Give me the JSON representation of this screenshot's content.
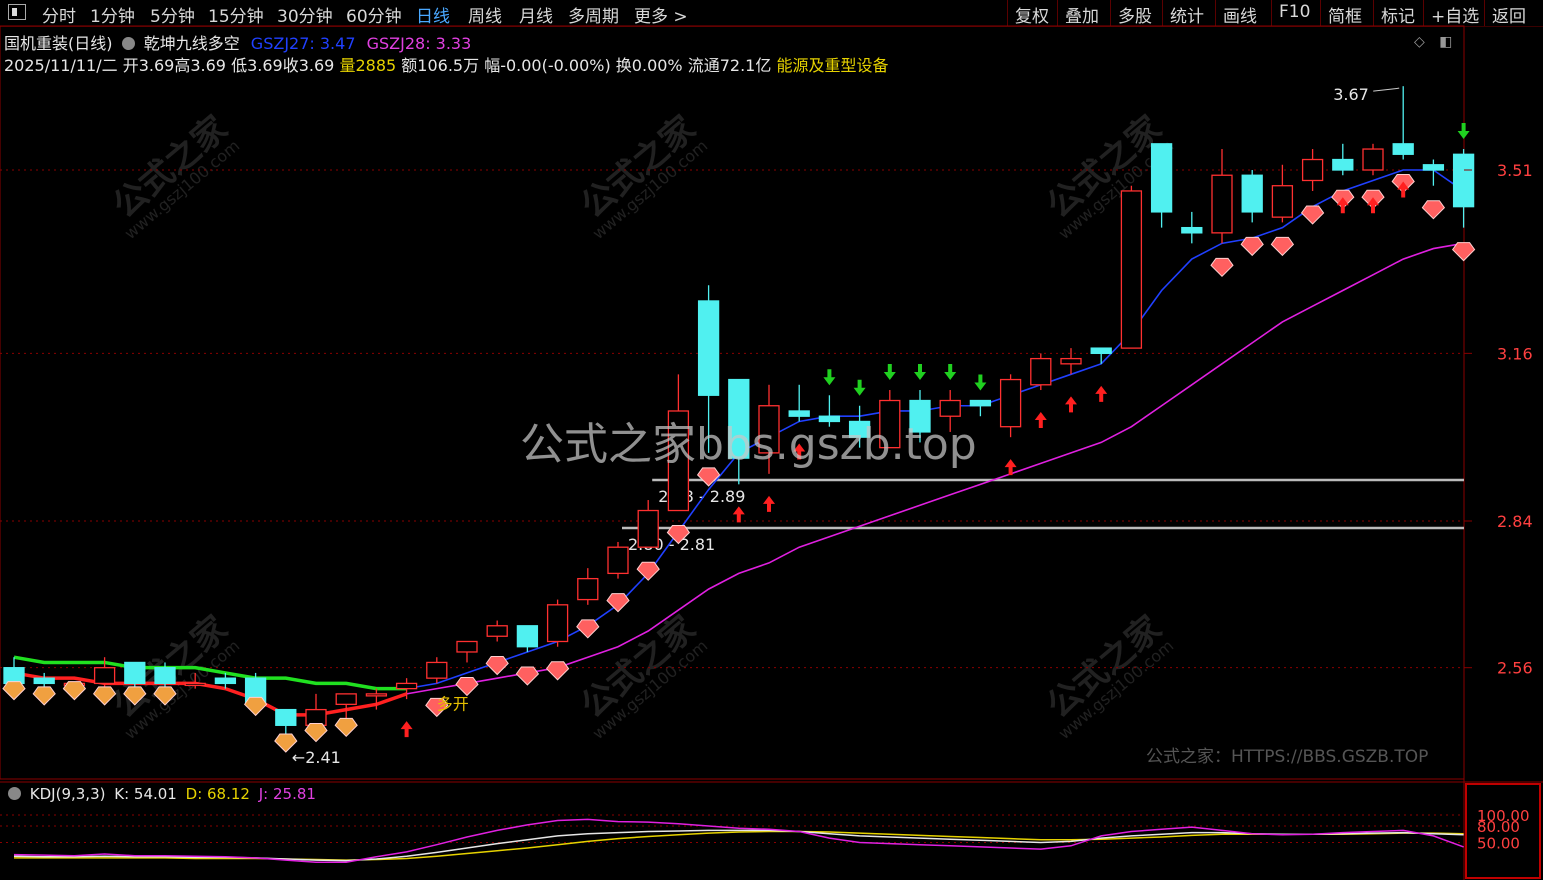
{
  "menu": {
    "left_items": [
      "分时",
      "1分钟",
      "5分钟",
      "15分钟",
      "30分钟",
      "60分钟",
      "日线",
      "周线",
      "月线",
      "多周期",
      "更多 >"
    ],
    "active": "日线",
    "right_items": [
      "复权",
      "叠加",
      "多股",
      "统计",
      "画线",
      "F10",
      "简框",
      "标记",
      "+自选",
      "返回"
    ]
  },
  "header": {
    "stock_name": "国机重装(日线)",
    "indicator_name": "乾坤九线多空",
    "ind1": "GSZJ27: 3.47",
    "ind2": "GSZJ28: 3.33",
    "date": "2025/11/11/二",
    "open": "开3.69",
    "high": "高3.69",
    "low": "低3.69",
    "close": "收3.69",
    "volume": "量2885",
    "amount": "额106.5万",
    "change": "幅-0.00(-0.00%)",
    "turnover": "换0.00%",
    "float_cap": "流通72.1亿",
    "sector": "能源及重型设备"
  },
  "colors": {
    "up": "#ff3030",
    "down": "#50f0f0",
    "ma_blue": "#2040ff",
    "ma_purple": "#e020e0",
    "bull_line": "#20e020",
    "bear_line": "#ff2020",
    "arrow_up": "#ff2020",
    "arrow_down": "#20d020",
    "bg": "#000000",
    "grid": "#8a0000"
  },
  "chart_data": {
    "type": "candlestick",
    "price_axis_ticks": [
      "3.51",
      "3.16",
      "2.84",
      "2.56"
    ],
    "candles": [
      {
        "o": 2.56,
        "h": 2.58,
        "l": 2.52,
        "c": 2.53
      },
      {
        "o": 2.54,
        "h": 2.55,
        "l": 2.51,
        "c": 2.53
      },
      {
        "o": 2.53,
        "h": 2.53,
        "l": 2.52,
        "c": 2.53
      },
      {
        "o": 2.53,
        "h": 2.58,
        "l": 2.51,
        "c": 2.56
      },
      {
        "o": 2.57,
        "h": 2.57,
        "l": 2.51,
        "c": 2.53
      },
      {
        "o": 2.56,
        "h": 2.57,
        "l": 2.51,
        "c": 2.53
      },
      {
        "o": 2.53,
        "h": 2.55,
        "l": 2.52,
        "c": 2.53
      },
      {
        "o": 2.54,
        "h": 2.55,
        "l": 2.52,
        "c": 2.53
      },
      {
        "o": 2.54,
        "h": 2.55,
        "l": 2.49,
        "c": 2.49
      },
      {
        "o": 2.48,
        "h": 2.48,
        "l": 2.42,
        "c": 2.45
      },
      {
        "o": 2.45,
        "h": 2.51,
        "l": 2.44,
        "c": 2.48
      },
      {
        "o": 2.49,
        "h": 2.51,
        "l": 2.45,
        "c": 2.51
      },
      {
        "o": 2.51,
        "h": 2.52,
        "l": 2.48,
        "c": 2.51
      },
      {
        "o": 2.52,
        "h": 2.54,
        "l": 2.5,
        "c": 2.53
      },
      {
        "o": 2.54,
        "h": 2.58,
        "l": 2.53,
        "c": 2.57
      },
      {
        "o": 2.59,
        "h": 2.61,
        "l": 2.57,
        "c": 2.61
      },
      {
        "o": 2.62,
        "h": 2.65,
        "l": 2.61,
        "c": 2.64
      },
      {
        "o": 2.64,
        "h": 2.64,
        "l": 2.59,
        "c": 2.6
      },
      {
        "o": 2.61,
        "h": 2.69,
        "l": 2.6,
        "c": 2.68
      },
      {
        "o": 2.69,
        "h": 2.75,
        "l": 2.68,
        "c": 2.73
      },
      {
        "o": 2.74,
        "h": 2.8,
        "l": 2.73,
        "c": 2.79
      },
      {
        "o": 2.79,
        "h": 2.88,
        "l": 2.79,
        "c": 2.86
      },
      {
        "o": 2.86,
        "h": 3.12,
        "l": 2.86,
        "c": 3.05
      },
      {
        "o": 3.26,
        "h": 3.29,
        "l": 2.97,
        "c": 3.08
      },
      {
        "o": 3.11,
        "h": 3.11,
        "l": 2.91,
        "c": 2.96
      },
      {
        "o": 2.97,
        "h": 3.1,
        "l": 2.93,
        "c": 3.06
      },
      {
        "o": 3.05,
        "h": 3.1,
        "l": 3.03,
        "c": 3.04
      },
      {
        "o": 3.04,
        "h": 3.08,
        "l": 3.02,
        "c": 3.03
      },
      {
        "o": 3.03,
        "h": 3.06,
        "l": 2.98,
        "c": 3.0
      },
      {
        "o": 2.98,
        "h": 3.09,
        "l": 2.98,
        "c": 3.07
      },
      {
        "o": 3.07,
        "h": 3.09,
        "l": 2.99,
        "c": 3.01
      },
      {
        "o": 3.04,
        "h": 3.09,
        "l": 3.01,
        "c": 3.07
      },
      {
        "o": 3.07,
        "h": 3.07,
        "l": 3.04,
        "c": 3.06
      },
      {
        "o": 3.02,
        "h": 3.12,
        "l": 3.0,
        "c": 3.11
      },
      {
        "o": 3.1,
        "h": 3.16,
        "l": 3.09,
        "c": 3.15
      },
      {
        "o": 3.14,
        "h": 3.17,
        "l": 3.12,
        "c": 3.15
      },
      {
        "o": 3.17,
        "h": 3.17,
        "l": 3.14,
        "c": 3.16
      },
      {
        "o": 3.17,
        "h": 3.48,
        "l": 3.17,
        "c": 3.47
      },
      {
        "o": 3.56,
        "h": 3.56,
        "l": 3.4,
        "c": 3.43
      },
      {
        "o": 3.4,
        "h": 3.43,
        "l": 3.37,
        "c": 3.39
      },
      {
        "o": 3.39,
        "h": 3.55,
        "l": 3.37,
        "c": 3.5
      },
      {
        "o": 3.5,
        "h": 3.51,
        "l": 3.41,
        "c": 3.43
      },
      {
        "o": 3.42,
        "h": 3.52,
        "l": 3.41,
        "c": 3.48
      },
      {
        "o": 3.49,
        "h": 3.55,
        "l": 3.47,
        "c": 3.53
      },
      {
        "o": 3.53,
        "h": 3.56,
        "l": 3.5,
        "c": 3.51
      },
      {
        "o": 3.51,
        "h": 3.56,
        "l": 3.5,
        "c": 3.55
      },
      {
        "o": 3.56,
        "h": 3.67,
        "l": 3.53,
        "c": 3.54
      },
      {
        "o": 3.52,
        "h": 3.53,
        "l": 3.48,
        "c": 3.51
      },
      {
        "o": 3.54,
        "h": 3.55,
        "l": 3.4,
        "c": 3.44
      }
    ],
    "ma_blue": [
      null,
      null,
      null,
      null,
      null,
      null,
      null,
      null,
      null,
      null,
      null,
      null,
      null,
      2.52,
      2.53,
      2.55,
      2.57,
      2.59,
      2.61,
      2.64,
      2.68,
      2.74,
      2.82,
      2.9,
      2.97,
      3.0,
      3.03,
      3.04,
      3.04,
      3.05,
      3.05,
      3.06,
      3.06,
      3.08,
      3.1,
      3.12,
      3.14,
      3.2,
      3.28,
      3.34,
      3.37,
      3.38,
      3.4,
      3.44,
      3.47,
      3.49,
      3.51,
      3.51,
      3.47
    ],
    "ma_purple": [
      null,
      null,
      null,
      null,
      null,
      null,
      null,
      null,
      null,
      null,
      null,
      null,
      null,
      2.51,
      2.52,
      2.53,
      2.54,
      2.55,
      2.56,
      2.58,
      2.6,
      2.63,
      2.67,
      2.71,
      2.74,
      2.76,
      2.79,
      2.81,
      2.83,
      2.85,
      2.87,
      2.89,
      2.91,
      2.93,
      2.95,
      2.97,
      2.99,
      3.02,
      3.06,
      3.1,
      3.14,
      3.18,
      3.22,
      3.25,
      3.28,
      3.31,
      3.34,
      3.36,
      3.37
    ],
    "bull_line": [
      2.58,
      2.57,
      2.57,
      2.57,
      2.56,
      2.56,
      2.56,
      2.55,
      2.54,
      2.54,
      2.53,
      2.53,
      2.52,
      2.52
    ],
    "bear_line": [
      2.55,
      2.54,
      2.54,
      2.53,
      2.53,
      2.53,
      2.53,
      2.52,
      2.5,
      2.47,
      2.47,
      2.48,
      2.49,
      2.51
    ],
    "zones": [
      {
        "label": "2.88 - 2.89",
        "price": 2.88,
        "from": 21
      },
      {
        "label": "2.80 - 2.81",
        "price": 2.8,
        "from": 20
      }
    ],
    "annotations": {
      "high_label": "3.67",
      "low_label": "2.41",
      "signal_label": "多开"
    },
    "gem_markers": [
      0,
      1,
      2,
      3,
      4,
      5,
      8,
      9,
      10,
      11,
      14,
      15,
      16,
      17,
      18,
      19,
      20,
      21,
      22,
      23,
      40,
      41,
      42,
      43,
      44,
      45,
      46,
      47,
      48,
      49
    ],
    "arrow_up_markers": [
      13,
      24,
      25,
      26,
      33,
      34,
      35,
      36,
      44,
      45,
      46
    ],
    "arrow_down_markers": [
      27,
      28,
      29,
      30,
      31,
      32,
      48
    ],
    "kdj": {
      "label": "KDJ(9,3,3)",
      "k": "K: 54.01",
      "d": "D: 68.12",
      "j": "J: 25.81",
      "axis": [
        "100.00",
        "80.00",
        "50.00"
      ],
      "k_values": [
        25,
        24,
        24,
        25,
        24,
        24,
        23,
        23,
        22,
        20,
        18,
        17,
        20,
        25,
        32,
        40,
        48,
        55,
        62,
        66,
        68,
        70,
        71,
        72,
        72,
        72,
        70,
        66,
        62,
        60,
        58,
        56,
        54,
        52,
        50,
        52,
        58,
        62,
        65,
        68,
        68,
        66,
        65,
        65,
        66,
        67,
        68,
        66,
        64
      ],
      "d_values": [
        22,
        22,
        22,
        22,
        22,
        22,
        21,
        21,
        21,
        20,
        19,
        18,
        19,
        21,
        25,
        30,
        35,
        40,
        46,
        52,
        57,
        61,
        64,
        67,
        69,
        70,
        70,
        69,
        67,
        65,
        63,
        61,
        59,
        57,
        55,
        55,
        56,
        58,
        60,
        63,
        65,
        65,
        65,
        65,
        65,
        66,
        67,
        67,
        66
      ],
      "j_values": [
        28,
        27,
        26,
        29,
        26,
        26,
        25,
        24,
        22,
        18,
        14,
        14,
        24,
        33,
        46,
        60,
        72,
        82,
        90,
        92,
        88,
        87,
        84,
        80,
        76,
        74,
        70,
        58,
        50,
        48,
        46,
        44,
        42,
        40,
        38,
        44,
        62,
        70,
        74,
        78,
        72,
        66,
        64,
        65,
        68,
        70,
        72,
        62,
        42
      ]
    }
  },
  "watermarks": {
    "center": "公式之家bbs.gszb.top",
    "site": "公式之家：HTTPS://BBS.GSZB.TOP",
    "diag_big": "公式之家",
    "diag_small": "www.gszj100.com"
  }
}
